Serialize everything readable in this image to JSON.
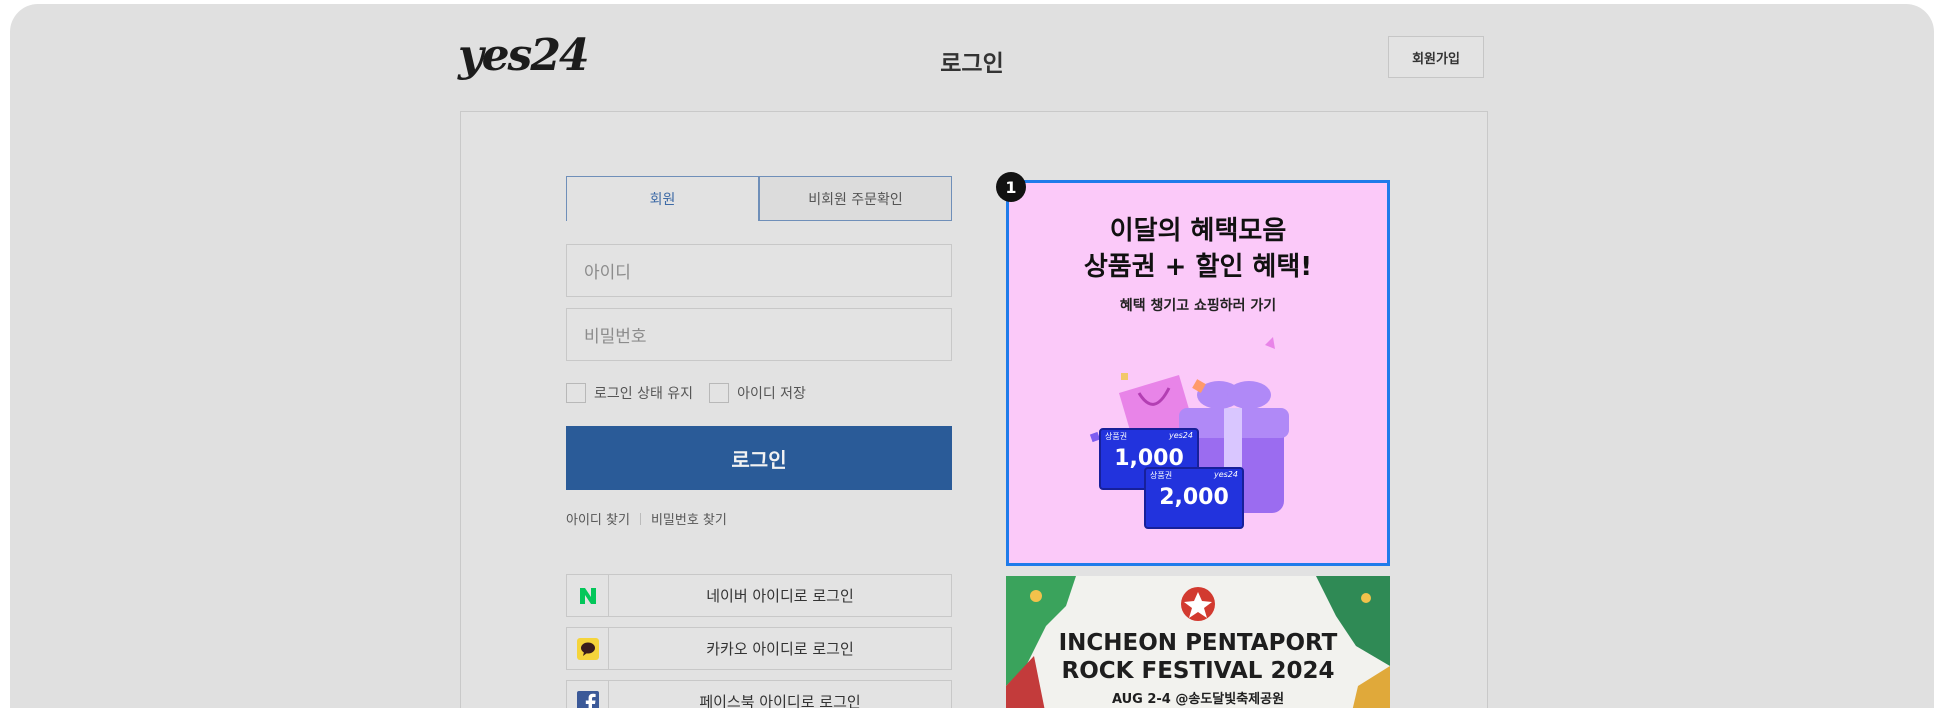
{
  "header": {
    "logo": "yes24",
    "title": "로그인",
    "signup_label": "회원가입"
  },
  "tabs": [
    {
      "label": "회원"
    },
    {
      "label": "비회원 주문확인"
    }
  ],
  "form": {
    "id_placeholder": "아이디",
    "pw_placeholder": "비밀번호",
    "keep_login_label": "로그인 상태 유지",
    "save_id_label": "아이디 저장",
    "login_label": "로그인",
    "find_id_label": "아이디 찾기",
    "find_pw_label": "비밀번호 찾기"
  },
  "social": [
    {
      "label": "네이버 아이디로 로그인",
      "icon": "naver-icon",
      "color": "#03c75a"
    },
    {
      "label": "카카오 아이디로 로그인",
      "icon": "kakao-icon",
      "color": "#f5d43b"
    },
    {
      "label": "페이스북 아이디로 로그인",
      "icon": "facebook-icon",
      "color": "#3b5998"
    }
  ],
  "banner1": {
    "badge": "1",
    "title_line1": "이달의 혜택모음",
    "title_line2": "상품권 + 할인 혜택!",
    "subtitle": "혜택 챙기고 쇼핑하러 가기",
    "coupon1_tag": "상품권",
    "coupon1_value": "1,000",
    "coupon2_tag": "상품권",
    "coupon2_value": "2,000",
    "coupon_brand": "yes24"
  },
  "banner2": {
    "line1": "INCHEON PENTAPORT",
    "line2": "ROCK FESTIVAL 2024",
    "line3": "AUG 2-4 @송도달빛축제공원"
  },
  "colors": {
    "primary": "#2a5b98",
    "accent_border": "#1f7bea",
    "banner_bg": "#fbc9f9"
  }
}
